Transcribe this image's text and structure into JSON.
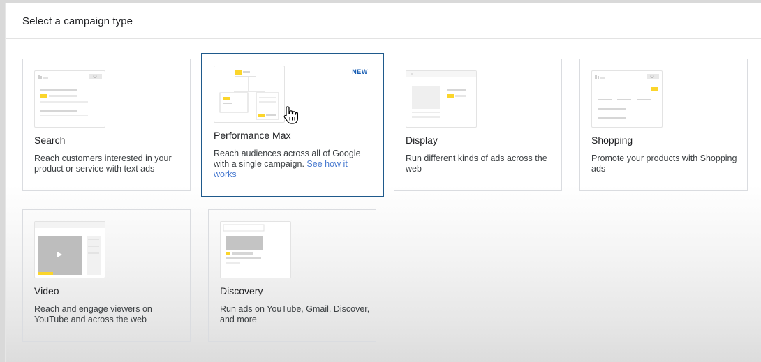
{
  "header": {
    "title": "Select a campaign type"
  },
  "cards": [
    {
      "title": "Search",
      "description": "Reach customers interested in your product or service with text ads"
    },
    {
      "title": "Performance Max",
      "badge": "NEW",
      "description": "Reach audiences across all of Google with a single campaign.",
      "link": "See how it works"
    },
    {
      "title": "Display",
      "description": "Run different kinds of ads across the web"
    },
    {
      "title": "Shopping",
      "description": "Promote your products with Shopping ads"
    },
    {
      "title": "Video",
      "description": "Reach and engage viewers on YouTube and across the web"
    },
    {
      "title": "Discovery",
      "description": "Run ads on YouTube, Gmail, Discover, and more"
    }
  ],
  "colors": {
    "selected_border": "#1f5a8c",
    "accent_yellow": "#fbd52b",
    "link": "#4a7bd0"
  }
}
